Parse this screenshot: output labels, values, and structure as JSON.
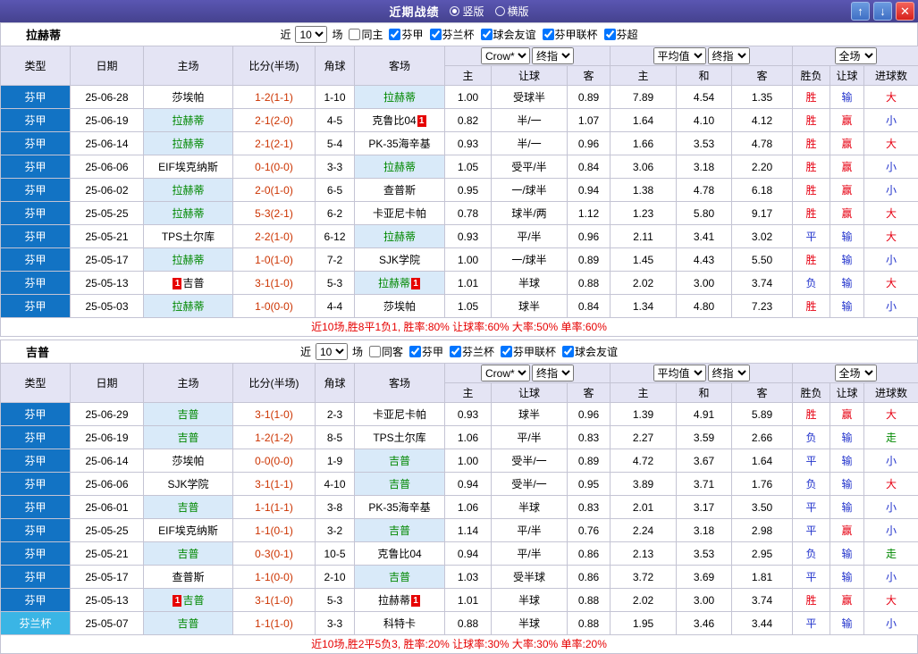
{
  "titlebar": {
    "title": "近期战绩",
    "radios": [
      {
        "label": "竖版",
        "checked": true
      },
      {
        "label": "横版",
        "checked": false
      }
    ],
    "up_icon": "↑",
    "down_icon": "↓",
    "close_icon": "✕"
  },
  "header": {
    "type": "类型",
    "date": "日期",
    "home": "主场",
    "score": "比分(半场)",
    "corner": "角球",
    "away": "客场",
    "provider1": "Crow*",
    "stage1": "终指",
    "provider2": "平均值",
    "stage2": "终指",
    "scope": "全场",
    "odds1_sub": [
      "主",
      "让球",
      "客"
    ],
    "odds2_sub": [
      "主",
      "和",
      "客"
    ],
    "result_sub": [
      "胜负",
      "让球",
      "进球数"
    ]
  },
  "sections": [
    {
      "team": "拉赫蒂",
      "filter": {
        "prefix": "近",
        "count": "10",
        "suffix": "场",
        "same_label": "同主",
        "same_checked": false,
        "leagues": [
          {
            "label": "芬甲",
            "checked": true
          },
          {
            "label": "芬兰杯",
            "checked": true
          },
          {
            "label": "球会友谊",
            "checked": true
          },
          {
            "label": "芬甲联杯",
            "checked": true
          },
          {
            "label": "芬超",
            "checked": true
          }
        ]
      },
      "rows": [
        {
          "type": "芬甲",
          "date": "25-06-28",
          "home": "莎埃帕",
          "score": "1-2(1-1)",
          "corner": "1-10",
          "away": "拉赫蒂",
          "o1": [
            "1.00",
            "受球半",
            "0.89"
          ],
          "o2": [
            "7.89",
            "4.54",
            "1.35"
          ],
          "res": "胜",
          "hcp": "输",
          "goals": "大"
        },
        {
          "type": "芬甲",
          "date": "25-06-19",
          "home": "拉赫蒂",
          "score": "2-1(2-0)",
          "corner": "4-5",
          "away": "克鲁比04",
          "away_badge": "1",
          "o1": [
            "0.82",
            "半/一",
            "1.07"
          ],
          "o2": [
            "1.64",
            "4.10",
            "4.12"
          ],
          "res": "胜",
          "hcp": "赢",
          "goals": "小"
        },
        {
          "type": "芬甲",
          "date": "25-06-14",
          "home": "拉赫蒂",
          "score": "2-1(2-1)",
          "corner": "5-4",
          "away": "PK-35海辛基",
          "o1": [
            "0.93",
            "半/一",
            "0.96"
          ],
          "o2": [
            "1.66",
            "3.53",
            "4.78"
          ],
          "res": "胜",
          "hcp": "赢",
          "goals": "大"
        },
        {
          "type": "芬甲",
          "date": "25-06-06",
          "home": "EIF埃克纳斯",
          "score": "0-1(0-0)",
          "corner": "3-3",
          "away": "拉赫蒂",
          "o1": [
            "1.05",
            "受平/半",
            "0.84"
          ],
          "o2": [
            "3.06",
            "3.18",
            "2.20"
          ],
          "res": "胜",
          "hcp": "赢",
          "goals": "小"
        },
        {
          "type": "芬甲",
          "date": "25-06-02",
          "home": "拉赫蒂",
          "score": "2-0(1-0)",
          "corner": "6-5",
          "away": "查普斯",
          "o1": [
            "0.95",
            "一/球半",
            "0.94"
          ],
          "o2": [
            "1.38",
            "4.78",
            "6.18"
          ],
          "res": "胜",
          "hcp": "赢",
          "goals": "小"
        },
        {
          "type": "芬甲",
          "date": "25-05-25",
          "home": "拉赫蒂",
          "score": "5-3(2-1)",
          "corner": "6-2",
          "away": "卡亚尼卡帕",
          "o1": [
            "0.78",
            "球半/两",
            "1.12"
          ],
          "o2": [
            "1.23",
            "5.80",
            "9.17"
          ],
          "res": "胜",
          "hcp": "赢",
          "goals": "大"
        },
        {
          "type": "芬甲",
          "date": "25-05-21",
          "home": "TPS土尔库",
          "score": "2-2(1-0)",
          "corner": "6-12",
          "away": "拉赫蒂",
          "o1": [
            "0.93",
            "平/半",
            "0.96"
          ],
          "o2": [
            "2.11",
            "3.41",
            "3.02"
          ],
          "res": "平",
          "hcp": "输",
          "goals": "大"
        },
        {
          "type": "芬甲",
          "date": "25-05-17",
          "home": "拉赫蒂",
          "score": "1-0(1-0)",
          "corner": "7-2",
          "away": "SJK学院",
          "o1": [
            "1.00",
            "一/球半",
            "0.89"
          ],
          "o2": [
            "1.45",
            "4.43",
            "5.50"
          ],
          "res": "胜",
          "hcp": "输",
          "goals": "小"
        },
        {
          "type": "芬甲",
          "date": "25-05-13",
          "home": "吉普",
          "home_badge": "1",
          "score": "3-1(1-0)",
          "corner": "5-3",
          "away": "拉赫蒂",
          "away_badge": "1",
          "o1": [
            "1.01",
            "半球",
            "0.88"
          ],
          "o2": [
            "2.02",
            "3.00",
            "3.74"
          ],
          "res": "负",
          "hcp": "输",
          "goals": "大"
        },
        {
          "type": "芬甲",
          "date": "25-05-03",
          "home": "拉赫蒂",
          "score": "1-0(0-0)",
          "corner": "4-4",
          "away": "莎埃帕",
          "o1": [
            "1.05",
            "球半",
            "0.84"
          ],
          "o2": [
            "1.34",
            "4.80",
            "7.23"
          ],
          "res": "胜",
          "hcp": "输",
          "goals": "小"
        }
      ],
      "summary": "近10场,胜8平1负1, 胜率:80% 让球率:60% 大率:50% 单率:60%"
    },
    {
      "team": "吉普",
      "filter": {
        "prefix": "近",
        "count": "10",
        "suffix": "场",
        "same_label": "同客",
        "same_checked": false,
        "leagues": [
          {
            "label": "芬甲",
            "checked": true
          },
          {
            "label": "芬兰杯",
            "checked": true
          },
          {
            "label": "芬甲联杯",
            "checked": true
          },
          {
            "label": "球会友谊",
            "checked": true
          }
        ]
      },
      "rows": [
        {
          "type": "芬甲",
          "date": "25-06-29",
          "home": "吉普",
          "score": "3-1(1-0)",
          "corner": "2-3",
          "away": "卡亚尼卡帕",
          "o1": [
            "0.93",
            "球半",
            "0.96"
          ],
          "o2": [
            "1.39",
            "4.91",
            "5.89"
          ],
          "res": "胜",
          "hcp": "赢",
          "goals": "大"
        },
        {
          "type": "芬甲",
          "date": "25-06-19",
          "home": "吉普",
          "score": "1-2(1-2)",
          "corner": "8-5",
          "away": "TPS土尔库",
          "o1": [
            "1.06",
            "平/半",
            "0.83"
          ],
          "o2": [
            "2.27",
            "3.59",
            "2.66"
          ],
          "res": "负",
          "hcp": "输",
          "goals": "走"
        },
        {
          "type": "芬甲",
          "date": "25-06-14",
          "home": "莎埃帕",
          "score": "0-0(0-0)",
          "corner": "1-9",
          "away": "吉普",
          "o1": [
            "1.00",
            "受半/一",
            "0.89"
          ],
          "o2": [
            "4.72",
            "3.67",
            "1.64"
          ],
          "res": "平",
          "hcp": "输",
          "goals": "小"
        },
        {
          "type": "芬甲",
          "date": "25-06-06",
          "home": "SJK学院",
          "score": "3-1(1-1)",
          "corner": "4-10",
          "away": "吉普",
          "o1": [
            "0.94",
            "受半/一",
            "0.95"
          ],
          "o2": [
            "3.89",
            "3.71",
            "1.76"
          ],
          "res": "负",
          "hcp": "输",
          "goals": "大"
        },
        {
          "type": "芬甲",
          "date": "25-06-01",
          "home": "吉普",
          "score": "1-1(1-1)",
          "corner": "3-8",
          "away": "PK-35海辛基",
          "o1": [
            "1.06",
            "半球",
            "0.83"
          ],
          "o2": [
            "2.01",
            "3.17",
            "3.50"
          ],
          "res": "平",
          "hcp": "输",
          "goals": "小"
        },
        {
          "type": "芬甲",
          "date": "25-05-25",
          "home": "EIF埃克纳斯",
          "score": "1-1(0-1)",
          "corner": "3-2",
          "away": "吉普",
          "o1": [
            "1.14",
            "平/半",
            "0.76"
          ],
          "o2": [
            "2.24",
            "3.18",
            "2.98"
          ],
          "res": "平",
          "hcp": "赢",
          "goals": "小"
        },
        {
          "type": "芬甲",
          "date": "25-05-21",
          "home": "吉普",
          "score": "0-3(0-1)",
          "corner": "10-5",
          "away": "克鲁比04",
          "o1": [
            "0.94",
            "平/半",
            "0.86"
          ],
          "o2": [
            "2.13",
            "3.53",
            "2.95"
          ],
          "res": "负",
          "hcp": "输",
          "goals": "走"
        },
        {
          "type": "芬甲",
          "date": "25-05-17",
          "home": "查普斯",
          "score": "1-1(0-0)",
          "corner": "2-10",
          "away": "吉普",
          "o1": [
            "1.03",
            "受半球",
            "0.86"
          ],
          "o2": [
            "3.72",
            "3.69",
            "1.81"
          ],
          "res": "平",
          "hcp": "输",
          "goals": "小"
        },
        {
          "type": "芬甲",
          "date": "25-05-13",
          "home": "吉普",
          "home_badge": "1",
          "score": "3-1(1-0)",
          "corner": "5-3",
          "away": "拉赫蒂",
          "away_badge": "1",
          "o1": [
            "1.01",
            "半球",
            "0.88"
          ],
          "o2": [
            "2.02",
            "3.00",
            "3.74"
          ],
          "res": "胜",
          "hcp": "赢",
          "goals": "大"
        },
        {
          "type": "芬兰杯",
          "date": "25-05-07",
          "home": "吉普",
          "score": "1-1(1-0)",
          "corner": "3-3",
          "away": "科特卡",
          "o1": [
            "0.88",
            "半球",
            "0.88"
          ],
          "o2": [
            "1.95",
            "3.46",
            "3.44"
          ],
          "res": "平",
          "hcp": "输",
          "goals": "小"
        }
      ],
      "summary": "近10场,胜2平5负3, 胜率:20% 让球率:30% 大率:30% 单率:20%"
    }
  ]
}
